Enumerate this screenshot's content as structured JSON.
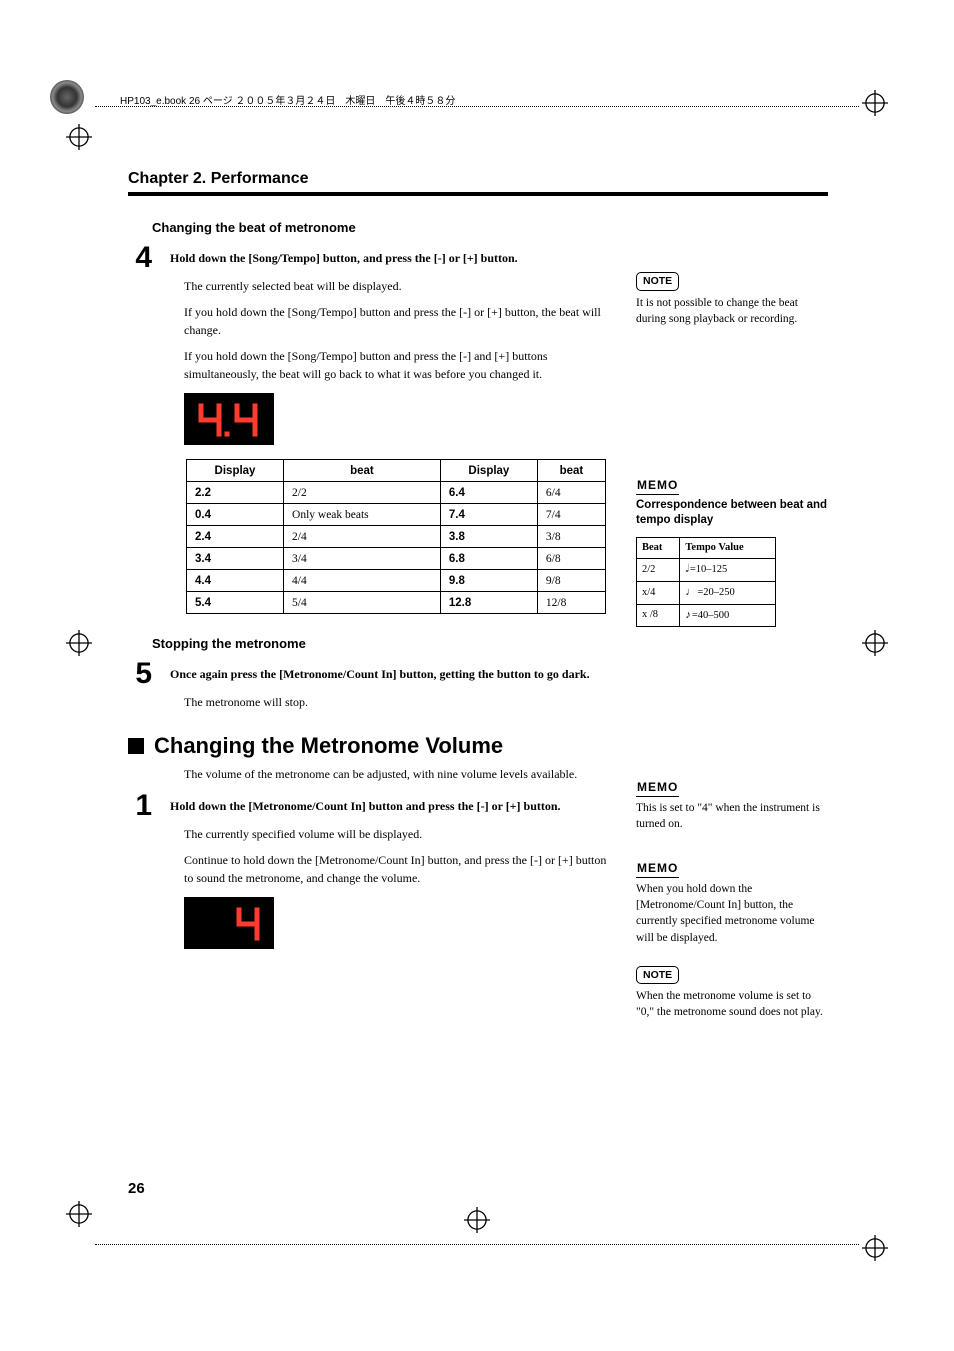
{
  "header": {
    "book_info": "HP103_e.book 26 ページ ２００５年３月２４日　木曜日　午後４時５８分"
  },
  "chapter_title": "Chapter 2. Performance",
  "section_changing_beat": {
    "title": "Changing the beat of metronome",
    "step_num": "4",
    "step_text": "Hold down the [Song/Tempo] button, and press the [-] or [+] button.",
    "p1": "The currently selected beat will be displayed.",
    "p2": "If you hold down the [Song/Tempo] button and press the [-] or [+] button, the beat will change.",
    "p3": "If you hold down the [Song/Tempo] button and press the [-] and [+] buttons simultaneously, the beat will go back to what it was before you changed it."
  },
  "beat_table": {
    "headers": [
      "Display",
      "beat",
      "Display",
      "beat"
    ],
    "rows": [
      [
        "2.2",
        "2/2",
        "6.4",
        "6/4"
      ],
      [
        "0.4",
        "Only weak beats",
        "7.4",
        "7/4"
      ],
      [
        "2.4",
        "2/4",
        "3.8",
        "3/8"
      ],
      [
        "3.4",
        "3/4",
        "6.8",
        "6/8"
      ],
      [
        "4.4",
        "4/4",
        "9.8",
        "9/8"
      ],
      [
        "5.4",
        "5/4",
        "12.8",
        "12/8"
      ]
    ]
  },
  "section_stopping": {
    "title": "Stopping the metronome",
    "step_num": "5",
    "step_text": "Once again press the [Metronome/Count In] button, getting the button to go dark.",
    "p1": "The metronome will stop."
  },
  "section_volume": {
    "title": "Changing the Metronome Volume",
    "intro": "The volume of the metronome can be adjusted, with nine volume levels available.",
    "step_num": "1",
    "step_text": "Hold down the [Metronome/Count In] button and press the [-] or [+] button.",
    "p1": "The currently specified volume will be displayed.",
    "p2": "Continue to hold down the [Metronome/Count In] button, and press the [-] or [+] button to sound the metronome, and change the volume."
  },
  "sidebar": {
    "note1": {
      "badge": "NOTE",
      "text": "It is not possible to change the beat during song playback or recording."
    },
    "memo1": {
      "badge": "MEMO",
      "heading": "Correspondence between beat and tempo display",
      "table": {
        "headers": [
          "Beat",
          "Tempo Value"
        ],
        "rows": [
          [
            "2/2",
            "=10–125"
          ],
          [
            "x/4",
            "=20–250"
          ],
          [
            "x /8",
            "=40–500"
          ]
        ]
      }
    },
    "memo2": {
      "badge": "MEMO",
      "text": "This is set to \"4\" when the instrument is turned on."
    },
    "memo3": {
      "badge": "MEMO",
      "text": "When you hold down the [Metronome/Count In] button, the currently specified metronome volume will be displayed."
    },
    "note2": {
      "badge": "NOTE",
      "text": "When the metronome volume is set to \"0,\" the metronome sound does not play."
    }
  },
  "page_number": "26",
  "chart_data": {
    "type": "table",
    "title": "Beat display mapping",
    "columns": [
      "Display",
      "beat"
    ],
    "rows": [
      {
        "Display": "2.2",
        "beat": "2/2"
      },
      {
        "Display": "0.4",
        "beat": "Only weak beats"
      },
      {
        "Display": "2.4",
        "beat": "2/4"
      },
      {
        "Display": "3.4",
        "beat": "3/4"
      },
      {
        "Display": "4.4",
        "beat": "4/4"
      },
      {
        "Display": "5.4",
        "beat": "5/4"
      },
      {
        "Display": "6.4",
        "beat": "6/4"
      },
      {
        "Display": "7.4",
        "beat": "7/4"
      },
      {
        "Display": "3.8",
        "beat": "3/8"
      },
      {
        "Display": "6.8",
        "beat": "6/8"
      },
      {
        "Display": "9.8",
        "beat": "9/8"
      },
      {
        "Display": "12.8",
        "beat": "12/8"
      }
    ]
  }
}
